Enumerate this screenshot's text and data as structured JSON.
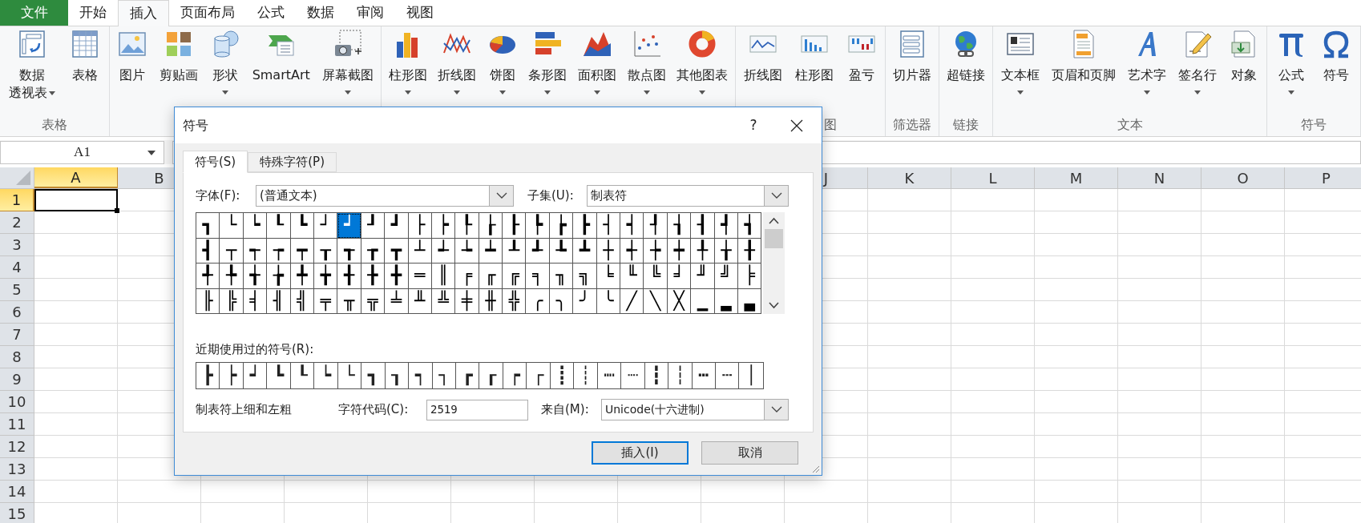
{
  "ribbon_tabs": [
    {
      "label": "文件",
      "kind": "file",
      "selected": false
    },
    {
      "label": "开始",
      "kind": "tab",
      "selected": false
    },
    {
      "label": "插入",
      "kind": "tab",
      "selected": true
    },
    {
      "label": "页面布局",
      "kind": "tab",
      "selected": false
    },
    {
      "label": "公式",
      "kind": "tab",
      "selected": false
    },
    {
      "label": "数据",
      "kind": "tab",
      "selected": false
    },
    {
      "label": "审阅",
      "kind": "tab",
      "selected": false
    },
    {
      "label": "视图",
      "kind": "tab",
      "selected": false
    }
  ],
  "ribbon_groups": [
    {
      "label": "表格",
      "buttons": [
        {
          "lines": [
            "数据",
            "透视表"
          ],
          "kind": "two-line",
          "dropdown": true
        },
        {
          "label": "表格",
          "kind": "large",
          "dropdown": false
        }
      ]
    },
    {
      "buttons": [
        {
          "label": "图片",
          "kind": "large",
          "dropdown": false
        },
        {
          "label": "剪贴画",
          "kind": "large",
          "dropdown": false
        },
        {
          "label": "形状",
          "kind": "large",
          "dropdown": true
        },
        {
          "label": "SmartArt",
          "kind": "large",
          "dropdown": false
        },
        {
          "label": "屏幕截图",
          "kind": "large",
          "dropdown": true
        }
      ]
    },
    {
      "buttons": [
        {
          "label": "柱形图",
          "kind": "large",
          "dropdown": true
        },
        {
          "label": "折线图",
          "kind": "large",
          "dropdown": true
        },
        {
          "label": "饼图",
          "kind": "large",
          "dropdown": true
        },
        {
          "label": "条形图",
          "kind": "large",
          "dropdown": true
        },
        {
          "label": "面积图",
          "kind": "large",
          "dropdown": true
        },
        {
          "label": "散点图",
          "kind": "large",
          "dropdown": true
        },
        {
          "label": "其他图表",
          "kind": "large",
          "dropdown": true
        }
      ]
    },
    {
      "label": "图",
      "buttons": [
        {
          "label": "折线图",
          "kind": "large",
          "dropdown": false
        },
        {
          "label": "柱形图",
          "kind": "large",
          "dropdown": false
        },
        {
          "label": "盈亏",
          "kind": "large",
          "dropdown": false
        }
      ]
    },
    {
      "label": "筛选器",
      "buttons": [
        {
          "label": "切片器",
          "kind": "large",
          "dropdown": false
        }
      ]
    },
    {
      "label": "链接",
      "buttons": [
        {
          "label": "超链接",
          "kind": "large",
          "dropdown": false
        }
      ]
    },
    {
      "label": "文本",
      "buttons": [
        {
          "label": "文本框",
          "kind": "large",
          "dropdown": true
        },
        {
          "label": "页眉和页脚",
          "kind": "large",
          "dropdown": false
        },
        {
          "label": "艺术字",
          "kind": "large",
          "dropdown": true
        },
        {
          "label": "签名行",
          "kind": "large",
          "dropdown": true
        },
        {
          "label": "对象",
          "kind": "large",
          "dropdown": false
        }
      ]
    },
    {
      "label": "符号",
      "buttons": [
        {
          "label": "公式",
          "kind": "large",
          "dropdown": true
        },
        {
          "label": "符号",
          "kind": "large",
          "dropdown": false
        }
      ]
    }
  ],
  "name_box": "A1",
  "columns": [
    {
      "label": "A",
      "selected": true
    },
    {
      "label": "B",
      "selected": false
    },
    {
      "label": "J",
      "selected": false
    },
    {
      "label": "K",
      "selected": false
    },
    {
      "label": "L",
      "selected": false
    },
    {
      "label": "M",
      "selected": false
    },
    {
      "label": "N",
      "selected": false
    },
    {
      "label": "O",
      "selected": false
    },
    {
      "label": "P",
      "selected": false
    }
  ],
  "rows": [
    {
      "label": "1",
      "selected": true
    },
    {
      "label": "2",
      "selected": false
    },
    {
      "label": "3",
      "selected": false
    },
    {
      "label": "4",
      "selected": false
    },
    {
      "label": "5",
      "selected": false
    },
    {
      "label": "6",
      "selected": false
    },
    {
      "label": "7",
      "selected": false
    },
    {
      "label": "8",
      "selected": false
    },
    {
      "label": "9",
      "selected": false
    },
    {
      "label": "10",
      "selected": false
    },
    {
      "label": "11",
      "selected": false
    },
    {
      "label": "12",
      "selected": false
    },
    {
      "label": "13",
      "selected": false
    },
    {
      "label": "14",
      "selected": false
    },
    {
      "label": "15",
      "selected": false
    }
  ],
  "dialog": {
    "title": "符号",
    "help": "?",
    "tabs": [
      {
        "label": "符号(S)",
        "selected": true
      },
      {
        "label": "特殊字符(P)",
        "selected": false
      }
    ],
    "font_label": "字体(F):",
    "font_value": "(普通文本)",
    "subset_label": "子集(U):",
    "subset_value": "制表符",
    "symbols": [
      {
        "char": "┓",
        "selected": false
      },
      {
        "char": "└",
        "selected": false
      },
      {
        "char": "┕",
        "selected": false
      },
      {
        "char": "┖",
        "selected": false
      },
      {
        "char": "┗",
        "selected": false
      },
      {
        "char": "┘",
        "selected": false
      },
      {
        "char": "┙",
        "selected": true
      },
      {
        "char": "┚",
        "selected": false
      },
      {
        "char": "┛",
        "selected": false
      },
      {
        "char": "├",
        "selected": false
      },
      {
        "char": "┝",
        "selected": false
      },
      {
        "char": "┞",
        "selected": false
      },
      {
        "char": "┟",
        "selected": false
      },
      {
        "char": "┠",
        "selected": false
      },
      {
        "char": "┡",
        "selected": false
      },
      {
        "char": "┢",
        "selected": false
      },
      {
        "char": "┣",
        "selected": false
      },
      {
        "char": "┤",
        "selected": false
      },
      {
        "char": "┥",
        "selected": false
      },
      {
        "char": "┦",
        "selected": false
      },
      {
        "char": "┧",
        "selected": false
      },
      {
        "char": "┨",
        "selected": false
      },
      {
        "char": "┩",
        "selected": false
      },
      {
        "char": "┪",
        "selected": false
      },
      {
        "char": "┫",
        "selected": false
      },
      {
        "char": "┬",
        "selected": false
      },
      {
        "char": "┭",
        "selected": false
      },
      {
        "char": "┮",
        "selected": false
      },
      {
        "char": "┯",
        "selected": false
      },
      {
        "char": "┰",
        "selected": false
      },
      {
        "char": "┱",
        "selected": false
      },
      {
        "char": "┲",
        "selected": false
      },
      {
        "char": "┳",
        "selected": false
      },
      {
        "char": "┴",
        "selected": false
      },
      {
        "char": "┵",
        "selected": false
      },
      {
        "char": "┶",
        "selected": false
      },
      {
        "char": "┷",
        "selected": false
      },
      {
        "char": "┸",
        "selected": false
      },
      {
        "char": "┹",
        "selected": false
      },
      {
        "char": "┺",
        "selected": false
      },
      {
        "char": "┻",
        "selected": false
      },
      {
        "char": "┼",
        "selected": false
      },
      {
        "char": "┽",
        "selected": false
      },
      {
        "char": "┾",
        "selected": false
      },
      {
        "char": "┿",
        "selected": false
      },
      {
        "char": "╀",
        "selected": false
      },
      {
        "char": "╁",
        "selected": false
      },
      {
        "char": "╂",
        "selected": false
      },
      {
        "char": "╃",
        "selected": false
      },
      {
        "char": "╄",
        "selected": false
      },
      {
        "char": "╅",
        "selected": false
      },
      {
        "char": "╆",
        "selected": false
      },
      {
        "char": "╇",
        "selected": false
      },
      {
        "char": "╈",
        "selected": false
      },
      {
        "char": "╉",
        "selected": false
      },
      {
        "char": "╊",
        "selected": false
      },
      {
        "char": "╋",
        "selected": false
      },
      {
        "char": "═",
        "selected": false
      },
      {
        "char": "║",
        "selected": false
      },
      {
        "char": "╒",
        "selected": false
      },
      {
        "char": "╓",
        "selected": false
      },
      {
        "char": "╔",
        "selected": false
      },
      {
        "char": "╕",
        "selected": false
      },
      {
        "char": "╖",
        "selected": false
      },
      {
        "char": "╗",
        "selected": false
      },
      {
        "char": "╘",
        "selected": false
      },
      {
        "char": "╙",
        "selected": false
      },
      {
        "char": "╚",
        "selected": false
      },
      {
        "char": "╛",
        "selected": false
      },
      {
        "char": "╜",
        "selected": false
      },
      {
        "char": "╝",
        "selected": false
      },
      {
        "char": "╞",
        "selected": false
      },
      {
        "char": "╟",
        "selected": false
      },
      {
        "char": "╠",
        "selected": false
      },
      {
        "char": "╡",
        "selected": false
      },
      {
        "char": "╢",
        "selected": false
      },
      {
        "char": "╣",
        "selected": false
      },
      {
        "char": "╤",
        "selected": false
      },
      {
        "char": "╥",
        "selected": false
      },
      {
        "char": "╦",
        "selected": false
      },
      {
        "char": "╧",
        "selected": false
      },
      {
        "char": "╨",
        "selected": false
      },
      {
        "char": "╩",
        "selected": false
      },
      {
        "char": "╪",
        "selected": false
      },
      {
        "char": "╫",
        "selected": false
      },
      {
        "char": "╬",
        "selected": false
      },
      {
        "char": "╭",
        "selected": false
      },
      {
        "char": "╮",
        "selected": false
      },
      {
        "char": "╯",
        "selected": false
      },
      {
        "char": "╰",
        "selected": false
      },
      {
        "char": "╱",
        "selected": false
      },
      {
        "char": "╲",
        "selected": false
      },
      {
        "char": "╳",
        "selected": false
      },
      {
        "char": "▁",
        "selected": false
      },
      {
        "char": "▂",
        "selected": false
      },
      {
        "char": "▃",
        "selected": false
      }
    ],
    "recent_label": "近期使用过的符号(R):",
    "recent_symbols": [
      "┣",
      "┝",
      "┙",
      "┗",
      "┖",
      "┕",
      "└",
      "┓",
      "┒",
      "┑",
      "┐",
      "┏",
      "┎",
      "┍",
      "┌",
      "┋",
      "┊",
      "┉",
      "┈",
      "┇",
      "┆",
      "┅",
      "┄",
      "│"
    ],
    "description": "制表符上细和左粗",
    "code_label": "字符代码(C):",
    "code_value": "2519",
    "from_label": "来自(M):",
    "from_value": "Unicode(十六进制)",
    "buttons": [
      {
        "label": "插入(I)",
        "kind": "primary"
      },
      {
        "label": "取消",
        "kind": "secondary"
      }
    ]
  }
}
